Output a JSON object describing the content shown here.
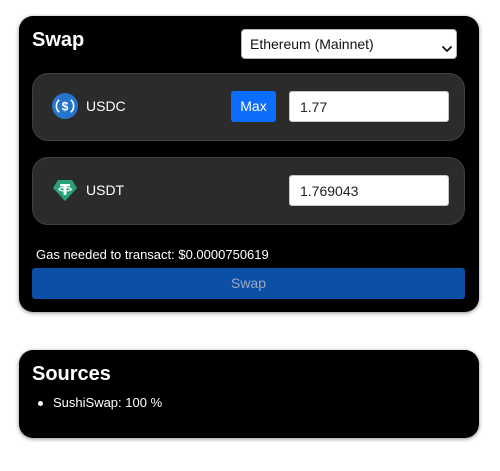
{
  "swap": {
    "title": "Swap",
    "network": "Ethereum (Mainnet)",
    "from_token": {
      "symbol": "USDC",
      "icon": "usdc-icon",
      "max_label": "Max",
      "amount": "1.77"
    },
    "to_token": {
      "symbol": "USDT",
      "icon": "usdt-icon",
      "amount": "1.769043"
    },
    "gas_text": "Gas needed to transact: $0.0000750619",
    "swap_label": "Swap"
  },
  "sources": {
    "title": "Sources",
    "items": [
      {
        "label": "SushiSwap: 100 %"
      }
    ]
  },
  "colors": {
    "card_bg": "#000000",
    "row_bg": "#2b2b2b",
    "max_button": "#0d6efd",
    "swap_button": "#0b4fa6",
    "usdc_blue": "#2775ca",
    "usdt_green": "#26a17b"
  }
}
